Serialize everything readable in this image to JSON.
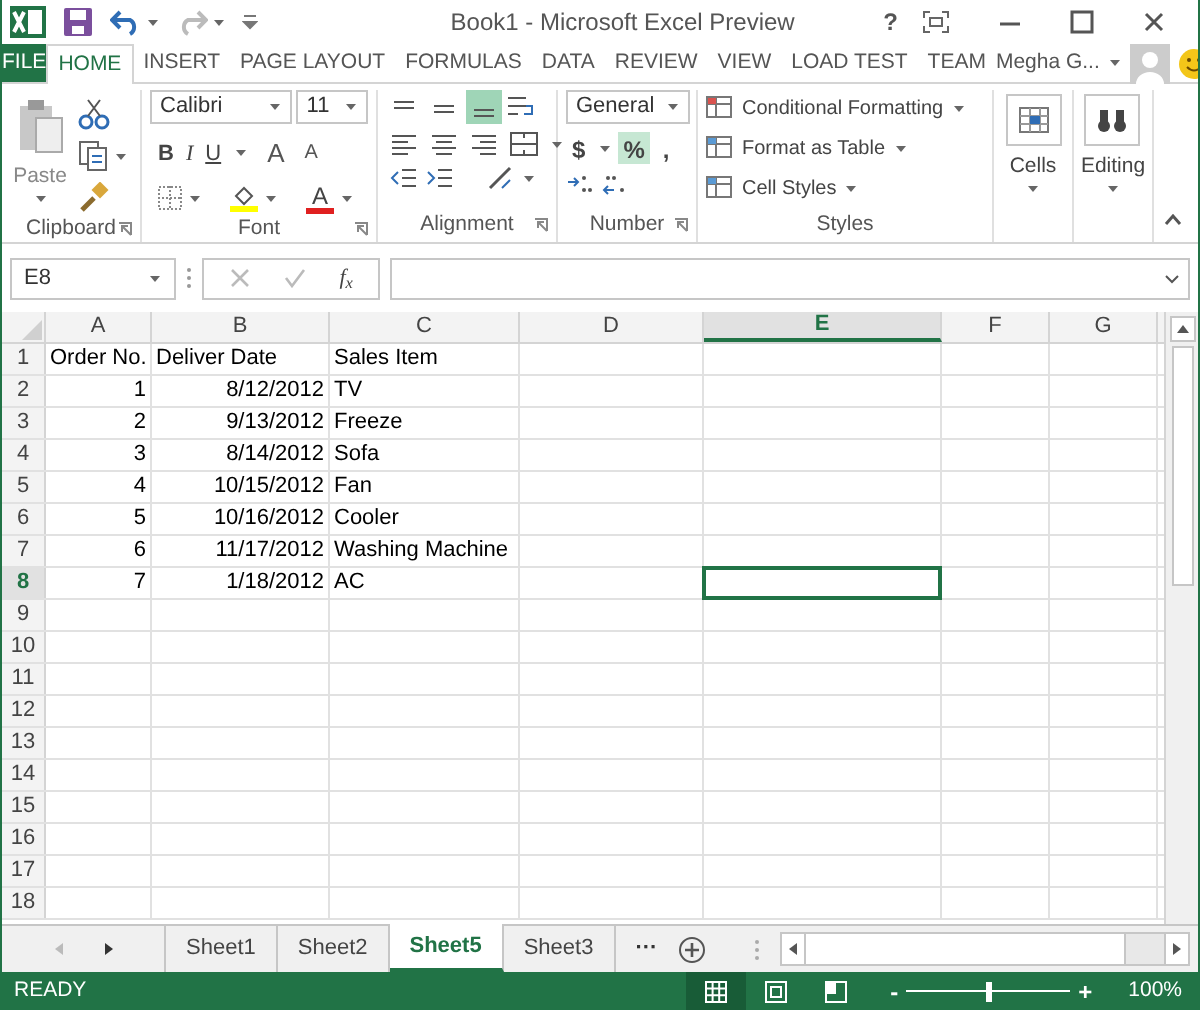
{
  "title_bar": {
    "title": "Book1 - Microsoft Excel Preview",
    "help": "?"
  },
  "ribbon_tabs": [
    {
      "label": "FILE",
      "kind": "file",
      "selected": false
    },
    {
      "label": "HOME",
      "kind": "tab",
      "selected": true
    },
    {
      "label": "INSERT",
      "kind": "tab",
      "selected": false
    },
    {
      "label": "PAGE LAYOUT",
      "kind": "tab",
      "selected": false
    },
    {
      "label": "FORMULAS",
      "kind": "tab",
      "selected": false
    },
    {
      "label": "DATA",
      "kind": "tab",
      "selected": false
    },
    {
      "label": "REVIEW",
      "kind": "tab",
      "selected": false
    },
    {
      "label": "VIEW",
      "kind": "tab",
      "selected": false
    },
    {
      "label": "LOAD TEST",
      "kind": "tab",
      "selected": false
    },
    {
      "label": "TEAM",
      "kind": "tab",
      "selected": false
    }
  ],
  "account": {
    "name": "Megha G..."
  },
  "ribbon": {
    "paste": "Paste",
    "font_name": "Calibri",
    "font_size": "11",
    "font_styles": [
      "B",
      "I",
      "U"
    ],
    "font_size_buttons": [
      "A",
      "A"
    ],
    "color_buttons": [
      {
        "kind": "fill",
        "color": "#ffff00"
      },
      {
        "kind": "font",
        "label": "A",
        "color": "#e02020"
      }
    ],
    "vertical_align": [
      {
        "selected": false
      },
      {
        "selected": false
      },
      {
        "selected": true
      }
    ],
    "number_format": "General",
    "number_buttons": [
      {
        "label": "$",
        "selected": false
      },
      {
        "label": "%",
        "selected": true
      },
      {
        "label": ",",
        "selected": false
      }
    ],
    "styles": [
      "Conditional Formatting",
      "Format as Table",
      "Cell Styles"
    ],
    "cells": "Cells",
    "editing": "Editing",
    "groups": [
      "Clipboard",
      "Font",
      "Alignment",
      "Number",
      "Styles"
    ]
  },
  "formula_bar": {
    "name_box": "E8",
    "function_label": "f$_{x}$"
  },
  "sheet": {
    "columns": [
      {
        "label": "A",
        "selected": false
      },
      {
        "label": "B",
        "selected": false
      },
      {
        "label": "C",
        "selected": false
      },
      {
        "label": "D",
        "selected": false
      },
      {
        "label": "E",
        "selected": true
      },
      {
        "label": "F",
        "selected": false
      },
      {
        "label": "G",
        "selected": false
      }
    ],
    "rows": [
      {
        "number": "1",
        "selected": false,
        "cells": [
          {
            "text": "Order No.",
            "kind": "text"
          },
          {
            "text": "Deliver Date",
            "kind": "text"
          },
          {
            "text": "Sales Item",
            "kind": "text"
          }
        ]
      },
      {
        "number": "2",
        "selected": false,
        "cells": [
          {
            "text": "1",
            "kind": "number"
          },
          {
            "text": "8/12/2012",
            "kind": "number"
          },
          {
            "text": "TV",
            "kind": "text"
          }
        ]
      },
      {
        "number": "3",
        "selected": false,
        "cells": [
          {
            "text": "2",
            "kind": "number"
          },
          {
            "text": "9/13/2012",
            "kind": "number"
          },
          {
            "text": "Freeze",
            "kind": "text"
          }
        ]
      },
      {
        "number": "4",
        "selected": false,
        "cells": [
          {
            "text": "3",
            "kind": "number"
          },
          {
            "text": "8/14/2012",
            "kind": "number"
          },
          {
            "text": "Sofa",
            "kind": "text"
          }
        ]
      },
      {
        "number": "5",
        "selected": false,
        "cells": [
          {
            "text": "4",
            "kind": "number"
          },
          {
            "text": "10/15/2012",
            "kind": "number"
          },
          {
            "text": "Fan",
            "kind": "text"
          }
        ]
      },
      {
        "number": "6",
        "selected": false,
        "cells": [
          {
            "text": "5",
            "kind": "number"
          },
          {
            "text": "10/16/2012",
            "kind": "number"
          },
          {
            "text": "Cooler",
            "kind": "text"
          }
        ]
      },
      {
        "number": "7",
        "selected": false,
        "cells": [
          {
            "text": "6",
            "kind": "number"
          },
          {
            "text": "11/17/2012",
            "kind": "number"
          },
          {
            "text": "Washing Machine",
            "kind": "text"
          }
        ]
      },
      {
        "number": "8",
        "selected": true,
        "cells": [
          {
            "text": "7",
            "kind": "number"
          },
          {
            "text": "1/18/2012",
            "kind": "number"
          },
          {
            "text": "AC",
            "kind": "text"
          }
        ]
      },
      {
        "number": "9",
        "selected": false,
        "cells": []
      },
      {
        "number": "10",
        "selected": false,
        "cells": []
      },
      {
        "number": "11",
        "selected": false,
        "cells": []
      },
      {
        "number": "12",
        "selected": false,
        "cells": []
      },
      {
        "number": "13",
        "selected": false,
        "cells": []
      },
      {
        "number": "14",
        "selected": false,
        "cells": []
      },
      {
        "number": "15",
        "selected": false,
        "cells": []
      },
      {
        "number": "16",
        "selected": false,
        "cells": []
      },
      {
        "number": "17",
        "selected": false,
        "cells": []
      },
      {
        "number": "18",
        "selected": false,
        "cells": []
      }
    ]
  },
  "sheet_tabs": [
    {
      "label": "Sheet1",
      "selected": false
    },
    {
      "label": "Sheet2",
      "selected": false
    },
    {
      "label": "Sheet5",
      "selected": true
    },
    {
      "label": "Sheet3",
      "selected": false
    }
  ],
  "more_sheets": "···",
  "status_bar": {
    "status": "READY",
    "views": [
      {
        "selected": true
      },
      {
        "selected": false
      },
      {
        "selected": false
      }
    ],
    "zoom_out": "-",
    "zoom_in": "+",
    "zoom": {
      "level": 0.5
    },
    "zoom_label": "100%"
  }
}
